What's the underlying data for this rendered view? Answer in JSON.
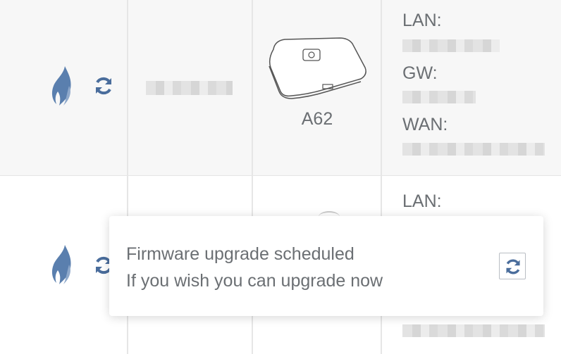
{
  "rows": [
    {
      "model": "A62",
      "labels": {
        "lan": "LAN:",
        "gw": "GW:",
        "wan": "WAN:"
      }
    },
    {
      "labels": {
        "lan": "LAN:"
      }
    }
  ],
  "toast": {
    "line1": "Firmware upgrade scheduled",
    "line2": "If you wish you can upgrade now"
  },
  "icons": {
    "status": "flame-icon",
    "refresh": "refresh-icon",
    "device": "router-device-icon"
  },
  "colors": {
    "icon_blue": "#5a7fae",
    "icon_dark_blue": "#4a6d9c",
    "text": "#6b6f73"
  }
}
